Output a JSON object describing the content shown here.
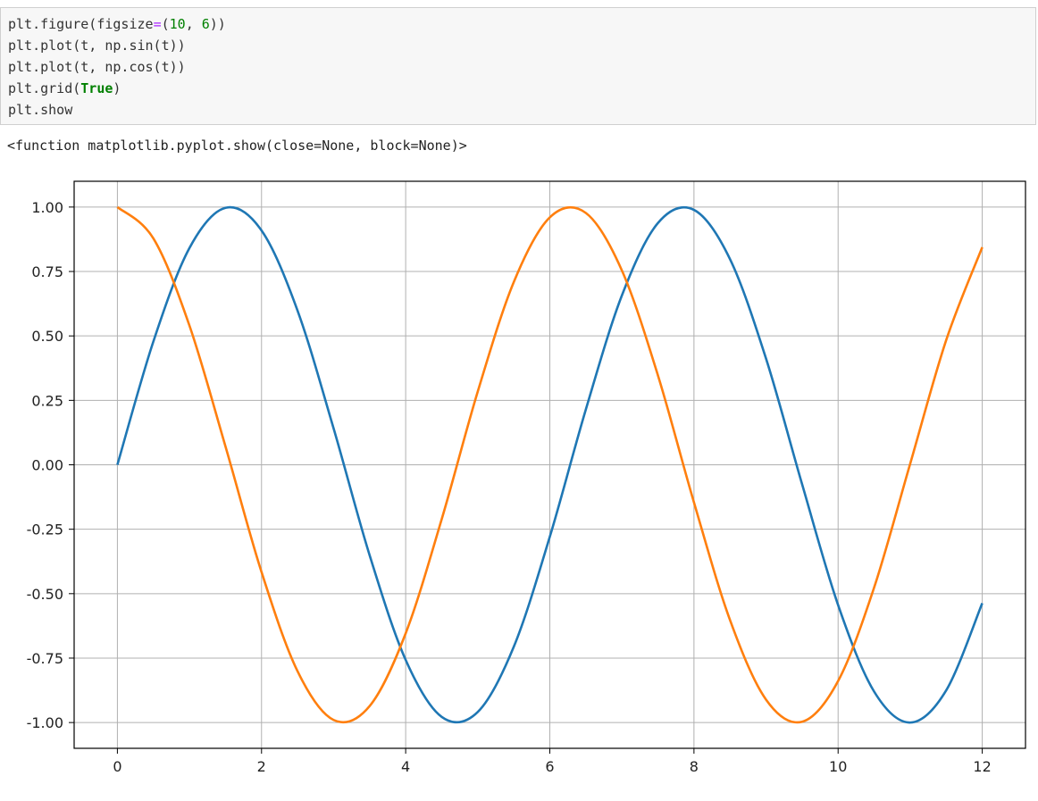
{
  "code_cell": {
    "lines": [
      [
        "plt.figure(figsize",
        "=",
        "(",
        "10",
        ", ",
        "6",
        "))"
      ],
      "plt.plot(t, np.sin(t))",
      "plt.plot(t, np.cos(t))",
      [
        "plt.grid(",
        "True",
        ")"
      ],
      "plt.show"
    ]
  },
  "output": {
    "text": "<function matplotlib.pyplot.show(close=None, block=None)>"
  },
  "chart_data": {
    "type": "line",
    "title": "",
    "xlabel": "",
    "ylabel": "",
    "xlim": [
      -0.6,
      12.6
    ],
    "ylim": [
      -1.1,
      1.1
    ],
    "grid": true,
    "x_ticks": [
      0,
      2,
      4,
      6,
      8,
      10,
      12
    ],
    "x_tick_labels": [
      "0",
      "2",
      "4",
      "6",
      "8",
      "10",
      "12"
    ],
    "y_ticks": [
      1.0,
      0.75,
      0.5,
      0.25,
      0.0,
      -0.25,
      -0.5,
      -0.75,
      -1.0
    ],
    "y_tick_labels": [
      "1.00",
      "0.75",
      "0.50",
      "0.25",
      "0.00",
      "-0.25",
      "-0.50",
      "-0.75",
      "-1.00"
    ],
    "x": [
      0,
      0.5,
      1,
      1.5,
      2,
      2.5,
      3,
      3.5,
      4,
      4.5,
      5,
      5.5,
      6,
      6.5,
      7,
      7.5,
      8,
      8.5,
      9,
      9.5,
      10,
      10.5,
      11,
      11.5,
      12
    ],
    "series": [
      {
        "color": "#1f77b4",
        "values": [
          0.0,
          0.479,
          0.841,
          0.997,
          0.909,
          0.598,
          0.141,
          -0.351,
          -0.757,
          -0.978,
          -0.959,
          -0.706,
          -0.279,
          0.215,
          0.657,
          0.938,
          0.989,
          0.798,
          0.412,
          -0.075,
          -0.544,
          -0.88,
          -1.0,
          -0.875,
          -0.537
        ]
      },
      {
        "color": "#ff7f0e",
        "values": [
          1.0,
          0.878,
          0.54,
          0.071,
          -0.416,
          -0.801,
          -0.99,
          -0.936,
          -0.654,
          -0.211,
          0.284,
          0.709,
          0.96,
          0.977,
          0.754,
          0.347,
          -0.146,
          -0.602,
          -0.911,
          -0.997,
          -0.839,
          -0.476,
          0.004,
          0.484,
          0.844
        ]
      }
    ]
  }
}
